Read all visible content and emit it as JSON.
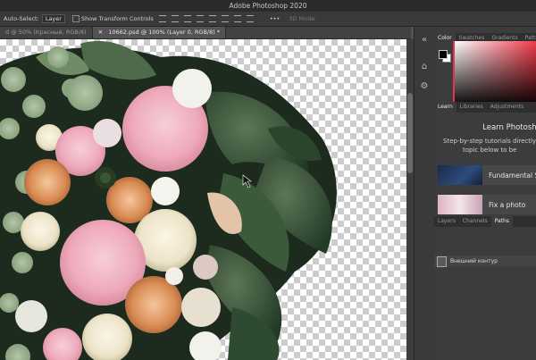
{
  "app": {
    "title": "Adobe Photoshop 2020"
  },
  "options_bar": {
    "auto_select_label": "Auto-Select:",
    "auto_select_value": "Layer",
    "transform_label": "Show Transform Controls",
    "mode_3d_label": "3D Mode:"
  },
  "doc_tabs": [
    {
      "label": "d @ 50% (Красный, RGB/8)"
    },
    {
      "label": "10662.psd @ 100% (Layer 0, RGB/8) *"
    }
  ],
  "color_panel": {
    "tabs": [
      "Color",
      "Swatches",
      "Gradients",
      "Patterns"
    ],
    "foreground": "#000000",
    "background": "#ffffff",
    "hue_color": "#f23a4a"
  },
  "learn_panel": {
    "tabs": [
      "Learn",
      "Libraries",
      "Adjustments"
    ],
    "title": "Learn Photosho",
    "desc_lines": [
      "Step-by-step tutorials directly i",
      "topic below to be"
    ],
    "cards": [
      {
        "label": "Fundamental S"
      },
      {
        "label": "Fix a photo"
      }
    ]
  },
  "layers_panel": {
    "tabs": [
      "Layers",
      "Channels",
      "Paths"
    ],
    "path_item": "Внешний контур"
  }
}
